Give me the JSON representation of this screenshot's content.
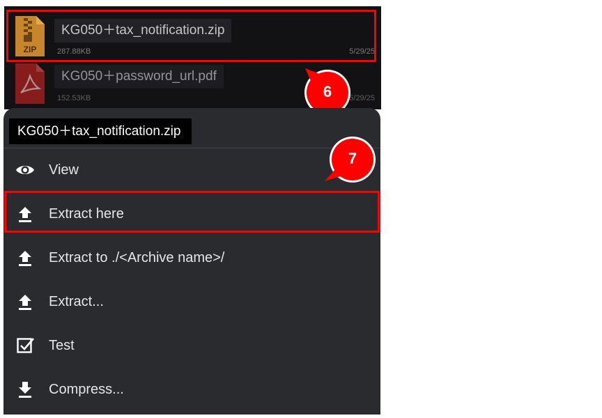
{
  "files": [
    {
      "name": "KG050＋tax_notification.zip",
      "size": "287.88KB",
      "date": "5/29/25",
      "icon": "zip-file-icon",
      "icon_text": "ZIP"
    },
    {
      "name": "KG050＋password_url.pdf",
      "size": "152.53KB",
      "date": "5/29/25",
      "icon": "pdf-file-icon"
    }
  ],
  "sheet": {
    "title": "KG050＋tax_notification.zip",
    "items": [
      {
        "label": "View",
        "icon": "eye-icon"
      },
      {
        "label": "Extract here",
        "icon": "upload-icon"
      },
      {
        "label": "Extract to ./<Archive name>/",
        "icon": "upload-icon"
      },
      {
        "label": "Extract...",
        "icon": "upload-icon"
      },
      {
        "label": "Test",
        "icon": "checkbox-icon"
      },
      {
        "label": "Compress...",
        "icon": "download-icon"
      }
    ]
  },
  "callouts": [
    {
      "number": "6"
    },
    {
      "number": "7"
    }
  ],
  "colors": {
    "callout": "#ff0000",
    "highlight": "#ff0000",
    "sheet_background": "#2a2b2f",
    "list_background": "#121214",
    "zip_icon": "#c8862c",
    "pdf_icon": "#b52020"
  }
}
